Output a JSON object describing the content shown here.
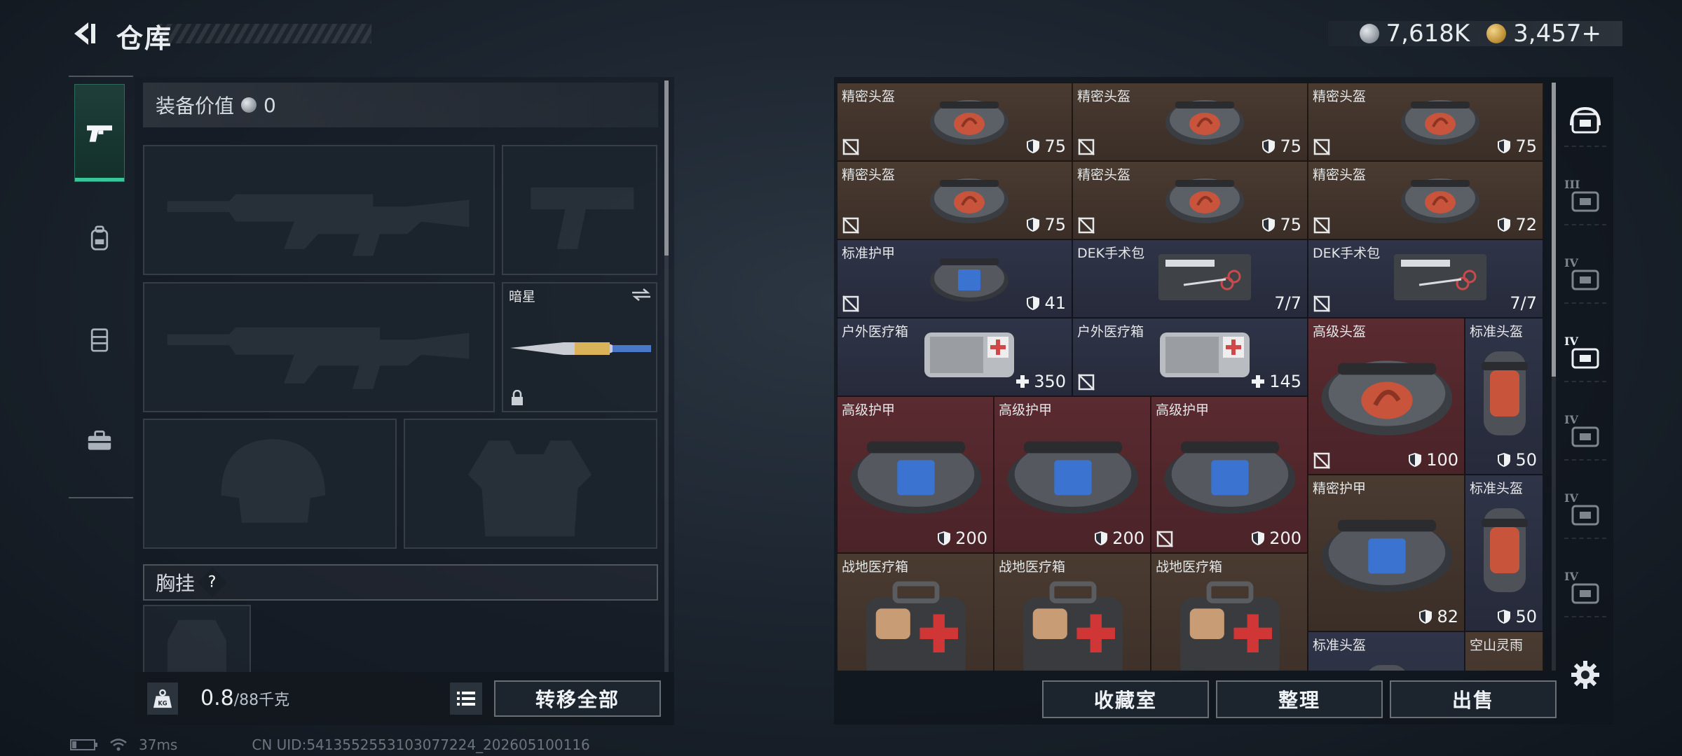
{
  "header": {
    "title": "仓库",
    "currency": [
      {
        "icon": "silver-coin-icon",
        "value": "7,618K"
      },
      {
        "icon": "gold-coin-icon",
        "value": "3,457+"
      }
    ]
  },
  "categories": [
    {
      "name": "pistol-icon",
      "active": true
    },
    {
      "name": "backpack-icon",
      "active": false
    },
    {
      "name": "vest-icon",
      "active": false
    },
    {
      "name": "toolbox-icon",
      "active": false
    }
  ],
  "equipment": {
    "value_label": "装备价值",
    "value": "0",
    "melee_label": "暗星",
    "chest_label": "胸挂",
    "help": "?"
  },
  "weight": {
    "current": "0.8",
    "capacity": "/88千克"
  },
  "buttons": {
    "transfer_all": "转移全部",
    "collection": "收藏室",
    "organize": "整理",
    "sell": "出售"
  },
  "storage": {
    "items": [
      {
        "name": "精密头盔",
        "value": "75",
        "kind": "shield",
        "lock": true,
        "color": "brown",
        "art": "helmet-orange"
      },
      {
        "name": "精密头盔",
        "value": "75",
        "kind": "shield",
        "lock": true,
        "color": "brown",
        "art": "helmet-orange"
      },
      {
        "name": "精密头盔",
        "value": "75",
        "kind": "shield",
        "lock": true,
        "color": "brown",
        "art": "helmet-orange"
      },
      {
        "name": "精密头盔",
        "value": "75",
        "kind": "shield",
        "lock": true,
        "color": "brown",
        "art": "helmet-orange"
      },
      {
        "name": "精密头盔",
        "value": "75",
        "kind": "shield",
        "lock": true,
        "color": "brown",
        "art": "helmet-orange"
      },
      {
        "name": "精密头盔",
        "value": "72",
        "kind": "shield",
        "lock": true,
        "color": "brown",
        "art": "helmet-orange"
      },
      {
        "name": "标准护甲",
        "value": "41",
        "kind": "shield",
        "lock": true,
        "color": "navy",
        "art": "vest-blue"
      },
      {
        "name": "DEK手术包",
        "value": "7/7",
        "kind": "count",
        "lock": false,
        "color": "navy",
        "art": "surgery-kit"
      },
      {
        "name": "DEK手术包",
        "value": "7/7",
        "kind": "count",
        "lock": true,
        "color": "navy",
        "art": "surgery-kit"
      },
      {
        "name": "户外医疗箱",
        "value": "350",
        "kind": "heal",
        "lock": false,
        "color": "navy",
        "art": "med-pouch"
      },
      {
        "name": "户外医疗箱",
        "value": "145",
        "kind": "heal",
        "lock": true,
        "color": "navy",
        "art": "med-pouch"
      },
      {
        "name": "高级头盔",
        "value": "100",
        "kind": "shield",
        "lock": true,
        "color": "red",
        "art": "helmet-orange"
      },
      {
        "name": "标准头盔",
        "value": "50",
        "kind": "shield",
        "lock": false,
        "color": "navy",
        "art": "helmet-small"
      },
      {
        "name": "高级护甲",
        "value": "200",
        "kind": "shield",
        "lock": false,
        "color": "red",
        "art": "vest-blue"
      },
      {
        "name": "高级护甲",
        "value": "200",
        "kind": "shield",
        "lock": false,
        "color": "red",
        "art": "vest-blue"
      },
      {
        "name": "高级护甲",
        "value": "200",
        "kind": "shield",
        "lock": true,
        "color": "red",
        "art": "vest-blue"
      },
      {
        "name": "精密护甲",
        "value": "82",
        "kind": "shield",
        "lock": false,
        "color": "brown",
        "art": "vest-blue"
      },
      {
        "name": "标准头盔",
        "value": "50",
        "kind": "shield",
        "lock": false,
        "color": "navy",
        "art": "helmet-small"
      },
      {
        "name": "战地医疗箱",
        "value": "",
        "kind": "none",
        "lock": false,
        "color": "brown",
        "art": "first-aid"
      },
      {
        "name": "战地医疗箱",
        "value": "",
        "kind": "none",
        "lock": false,
        "color": "brown",
        "art": "first-aid"
      },
      {
        "name": "战地医疗箱",
        "value": "",
        "kind": "none",
        "lock": false,
        "color": "brown",
        "art": "first-aid"
      },
      {
        "name": "标准头盔",
        "value": "",
        "kind": "none",
        "lock": false,
        "color": "navy",
        "art": "helmet-small"
      },
      {
        "name": "空山灵雨",
        "value": "",
        "kind": "none",
        "lock": false,
        "color": "brown",
        "art": "plant"
      }
    ]
  },
  "filters": [
    {
      "name": "helmet-filter-icon",
      "label": ""
    },
    {
      "name": "armor-filter-icon",
      "label": "III"
    },
    {
      "name": "rig-filter-icon",
      "label": "IV"
    },
    {
      "name": "medical-filter-icon",
      "label": "IV"
    },
    {
      "name": "medical-plus-filter-icon",
      "label": "IV"
    },
    {
      "name": "weapon-filter-icon",
      "label": "IV"
    },
    {
      "name": "key-filter-icon",
      "label": "IV"
    }
  ],
  "status": {
    "ping": "37ms",
    "uid": "CN UID:5413552553103077224_202605100116"
  },
  "colors": {
    "accent": "#39c79a",
    "brown": "#4a3b31",
    "navy": "#2f3448",
    "red": "#5a2b30"
  }
}
